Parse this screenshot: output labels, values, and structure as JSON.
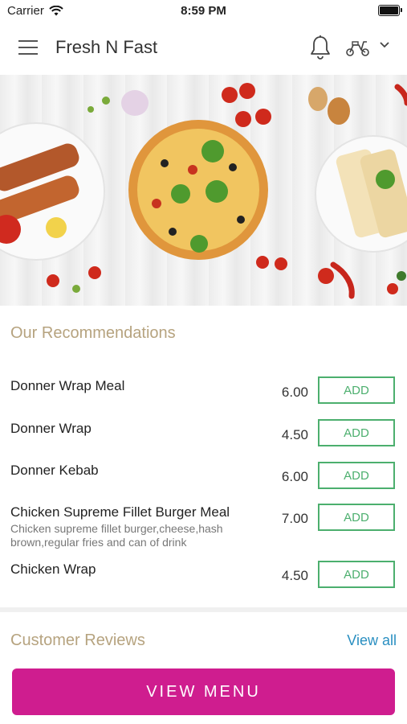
{
  "status_bar": {
    "carrier": "Carrier",
    "time": "8:59 PM"
  },
  "header": {
    "title": "Fresh N Fast"
  },
  "recommendations": {
    "title": "Our Recommendations",
    "items": [
      {
        "name": "Donner Wrap Meal",
        "description": "",
        "price": "6.00",
        "button": "ADD"
      },
      {
        "name": "Donner Wrap",
        "description": "",
        "price": "4.50",
        "button": "ADD"
      },
      {
        "name": "Donner Kebab",
        "description": "",
        "price": "6.00",
        "button": "ADD"
      },
      {
        "name": "Chicken Supreme Fillet Burger Meal",
        "description": "Chicken supreme fillet burger,cheese,hash brown,regular fries and can of drink",
        "price": "7.00",
        "button": "ADD"
      },
      {
        "name": "Chicken Wrap",
        "description": "",
        "price": "4.50",
        "button": "ADD"
      }
    ]
  },
  "reviews": {
    "title": "Customer Reviews",
    "view_all": "View all"
  },
  "footer": {
    "view_menu": "VIEW MENU"
  },
  "colors": {
    "accent": "#cf1d8f",
    "add_green": "#4caf6e",
    "section_title": "#b6a37f",
    "link": "#2a8fc1"
  },
  "icons": [
    "wifi-icon",
    "battery-icon",
    "menu-icon",
    "bell-icon",
    "scooter-icon",
    "chevron-down-icon"
  ]
}
